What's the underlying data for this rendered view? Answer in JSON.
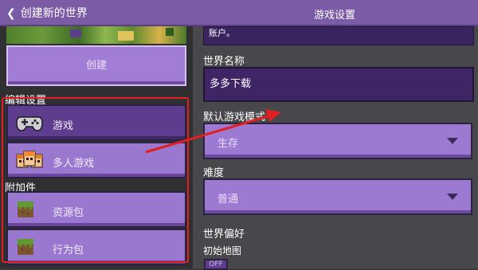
{
  "header": {
    "back_label": "创建新的世界",
    "title": "游戏设置"
  },
  "left_panel": {
    "create_label": "创建",
    "section_edit": "编辑设置",
    "section_addons": "附加件",
    "nav": [
      {
        "label": "游戏",
        "icon": "controller-icon",
        "selected": true
      },
      {
        "label": "多人游戏",
        "icon": "players-icon",
        "selected": false
      },
      {
        "label": "资源包",
        "icon": "grass-block-icon",
        "selected": false
      },
      {
        "label": "行为包",
        "icon": "grass-block-icon",
        "selected": false
      }
    ]
  },
  "right_panel": {
    "note_text": "账户。",
    "world_name_label": "世界名称",
    "world_name_value": "多多下载",
    "default_mode_label": "默认游戏模式",
    "default_mode_value": "生存",
    "difficulty_label": "难度",
    "difficulty_value": "普通",
    "world_prefs_label": "世界偏好",
    "starter_map_label": "初始地图",
    "starter_map_toggle": "OFF"
  },
  "colors": {
    "titlebar": "#7c5ba6",
    "button_purple": "#9b78cf",
    "selected_purple": "#5e3c8e",
    "annotation_red": "#e02020"
  }
}
